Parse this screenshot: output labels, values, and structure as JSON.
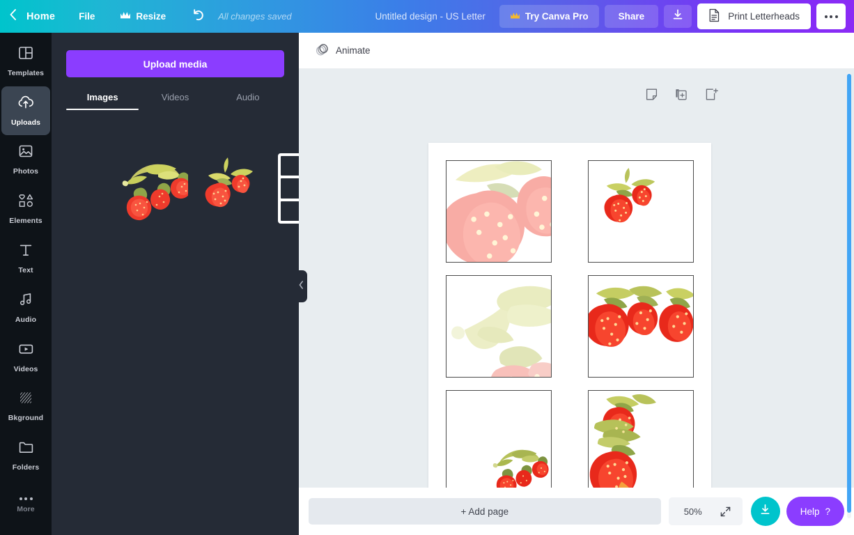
{
  "topbar": {
    "back_icon": "chevron-left-icon",
    "home_label": "Home",
    "file_label": "File",
    "resize_label": "Resize",
    "resize_icon": "crown-icon",
    "undo_icon": "undo-icon",
    "save_status": "All changes saved",
    "design_title": "Untitled design - US Letter",
    "pro_label": "Try Canva Pro",
    "pro_icon": "crown-icon",
    "share_label": "Share",
    "download_icon": "download-icon",
    "print_label": "Print Letterheads",
    "print_icon": "document-icon",
    "more_icon": "ellipsis-icon",
    "gradient_start": "#00c4cc",
    "gradient_end": "#8b2bf5"
  },
  "rail": {
    "items": [
      {
        "label": "Templates",
        "icon": "templates-icon",
        "active": false
      },
      {
        "label": "Uploads",
        "icon": "cloud-upload-icon",
        "active": true
      },
      {
        "label": "Photos",
        "icon": "photo-icon",
        "active": false
      },
      {
        "label": "Elements",
        "icon": "shapes-icon",
        "active": false
      },
      {
        "label": "Text",
        "icon": "text-icon",
        "active": false
      },
      {
        "label": "Audio",
        "icon": "music-note-icon",
        "active": false
      },
      {
        "label": "Videos",
        "icon": "video-icon",
        "active": false
      },
      {
        "label": "Bkground",
        "icon": "hatch-pattern-icon",
        "active": false
      },
      {
        "label": "Folders",
        "icon": "folder-icon",
        "active": false
      }
    ],
    "more_label": "More",
    "more_icon": "ellipsis-icon",
    "active_bg": "#3b4552",
    "bg": "#0e1318"
  },
  "panel": {
    "upload_button_label": "Upload media",
    "upload_button_color": "#8b3dff",
    "tabs": [
      {
        "label": "Images",
        "active": true
      },
      {
        "label": "Videos",
        "active": false
      },
      {
        "label": "Audio",
        "active": false
      }
    ],
    "uploads": [
      {
        "name": "strawberry-branch-thumbnail",
        "type": "image"
      },
      {
        "name": "strawberry-cluster-thumbnail",
        "type": "image"
      },
      {
        "name": "grid-frame-thumbnail",
        "type": "grid",
        "rows": 3,
        "cols": 2
      }
    ],
    "collapse_icon": "chevron-left-icon"
  },
  "editor": {
    "animate_label": "Animate",
    "animate_icon": "animate-icon",
    "page_tools": [
      {
        "name": "notes-icon",
        "label": "Notes"
      },
      {
        "name": "duplicate-page-icon",
        "label": "Duplicate page"
      },
      {
        "name": "add-page-icon",
        "label": "Add page"
      }
    ],
    "canvas_bg": "#e8edf0",
    "page_bg": "#ffffff",
    "cells": [
      {
        "position": "top-left",
        "content": "strawberry-closeup-faded"
      },
      {
        "position": "top-right",
        "content": "strawberry-pair-red"
      },
      {
        "position": "middle-left",
        "content": "strawberry-leaves-faded"
      },
      {
        "position": "middle-right",
        "content": "strawberry-trio-red"
      },
      {
        "position": "bottom-left",
        "content": "strawberry-branch-small"
      },
      {
        "position": "bottom-right",
        "content": "strawberry-vertical-red"
      }
    ]
  },
  "bottombar": {
    "add_page_label": "+ Add page",
    "zoom_level": "50%",
    "expand_icon": "expand-icon",
    "download_icon": "download-icon",
    "download_color": "#00c4cc",
    "help_label": "Help",
    "help_suffix": "?",
    "help_color": "#8b3dff"
  },
  "scrollbar": {
    "name": "canvas-vertical-scrollbar",
    "color": "#42a5f5"
  }
}
